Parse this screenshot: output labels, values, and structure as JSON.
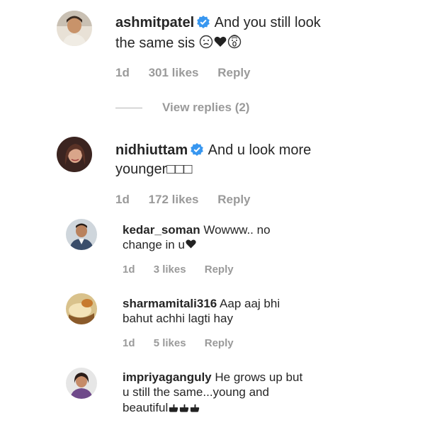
{
  "comments": [
    {
      "username": "ashmitpatel",
      "verified": true,
      "text_line1": "And you still look",
      "text_line2": "the same sis",
      "time": "1d",
      "likes": "301 likes",
      "reply": "Reply"
    },
    {
      "username": "nidhiuttam",
      "verified": true,
      "text_line1": "And u look more",
      "text_line2": "younger□□□",
      "time": "1d",
      "likes": "172 likes",
      "reply": "Reply"
    }
  ],
  "view_replies": "View replies (2)",
  "replies": [
    {
      "username": "kedar_soman",
      "text_line1": "Wowww.. no",
      "text_line2": "change in u",
      "time": "1d",
      "likes": "3 likes",
      "reply": "Reply"
    },
    {
      "username": "sharmamitali316",
      "text_line1": "Aap aaj bhi",
      "text_line2": "bahut achhi lagti hay",
      "time": "1d",
      "likes": "5 likes",
      "reply": "Reply"
    },
    {
      "username": "impriyaganguly",
      "text_line1": "He grows up but",
      "text_line2": "u still the same...young and",
      "text_line3": "beautiful",
      "time": "",
      "likes": "",
      "reply": ""
    }
  ],
  "colors": {
    "text": "#262626",
    "meta": "#9a9a9a",
    "verified": "#3897f0"
  }
}
